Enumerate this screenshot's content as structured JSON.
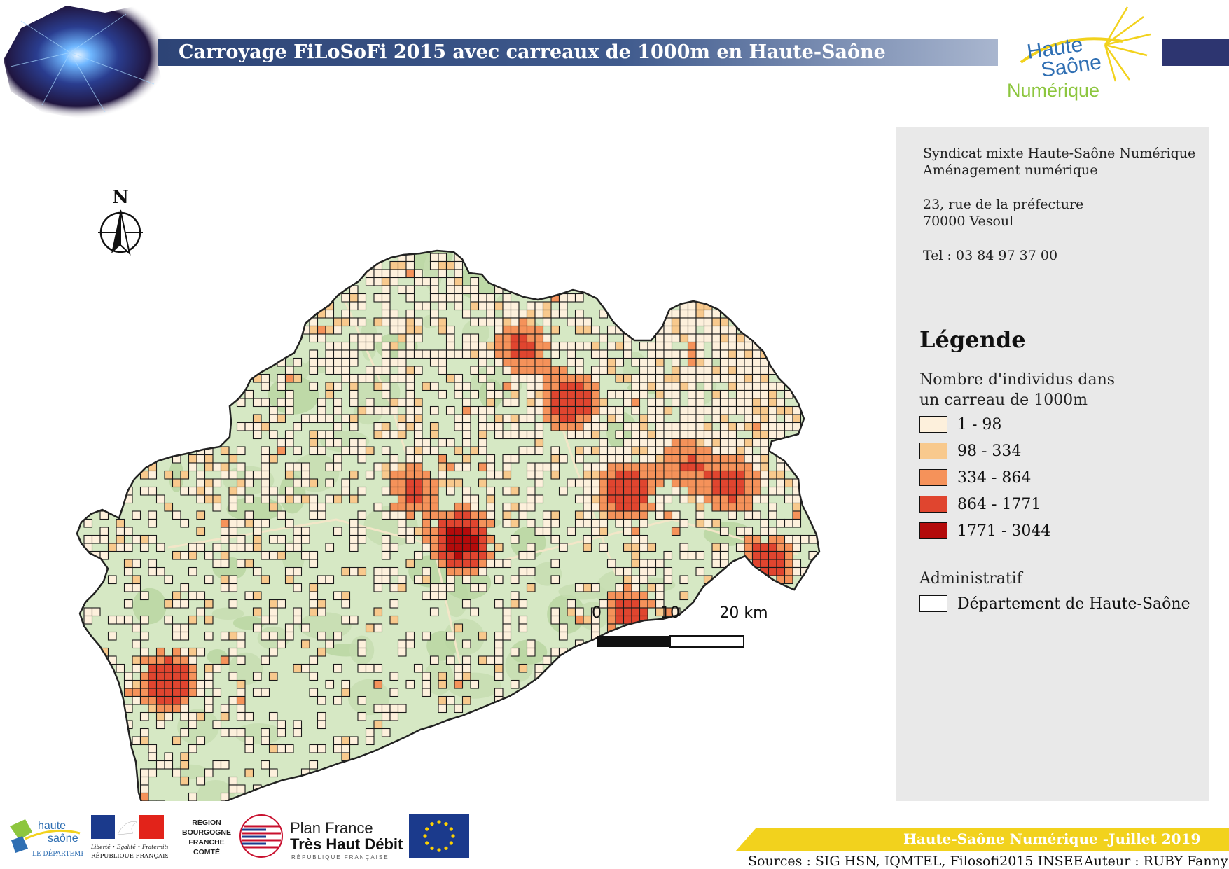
{
  "header": {
    "title": "Carroyage FiLoSoFi 2015 avec carreaux de 1000m en Haute-Saône",
    "logo": {
      "line1": "Haute",
      "line2": "Saône",
      "line3": "Numérique"
    }
  },
  "map": {
    "north_label": "N",
    "scale_bar": {
      "labels": [
        "0",
        "10",
        "20 km"
      ]
    }
  },
  "address": {
    "org": "Syndicat mixte Haute-Saône Numérique",
    "dept": "Aménagement numérique",
    "street": "23, rue de la préfecture",
    "city": "70000 Vesoul",
    "tel": "Tel : 03 84 97 37 00"
  },
  "legend": {
    "title": "Légende",
    "subtitle_line1": "Nombre d'individus dans",
    "subtitle_line2": "un carreau de 1000m",
    "classes": [
      {
        "label": "1 - 98",
        "color": "#fdf0dc"
      },
      {
        "label": "98 - 334",
        "color": "#f8c98d"
      },
      {
        "label": "334 - 864",
        "color": "#f5925a"
      },
      {
        "label": "864 - 1771",
        "color": "#e0452f"
      },
      {
        "label": "1771 - 3044",
        "color": "#b40b0b"
      }
    ],
    "admin_title": "Administratif",
    "admin_item": "Département de Haute-Saône"
  },
  "footer": {
    "banner": "Haute-Saône Numérique -Juillet 2019",
    "sources": "Sources : SIG HSN, IQMTEL, Filosofi2015 INSEE",
    "author": "Auteur : RUBY Fanny",
    "logos": {
      "haute_saone_1": "haute",
      "haute_saone_2": "saône",
      "haute_saone_3": "LE DÉPARTEMENT",
      "republique_motto": "Liberté • Égalité • Fraternité",
      "republique_name": "RÉPUBLIQUE FRANÇAISE",
      "region_1": "RÉGION",
      "region_2": "BOURGOGNE",
      "region_3": "FRANCHE",
      "region_4": "COMTÉ",
      "pfthd_1": "Plan France",
      "pfthd_2": "Très Haut Débit",
      "pfthd_3": "RÉPUBLIQUE FRANÇAISE"
    }
  },
  "colors": {
    "title_band": "#2d4476",
    "map_background": "#d6e8c4",
    "footer_band": "#f2d21d",
    "panel": "#e9e9e9"
  }
}
